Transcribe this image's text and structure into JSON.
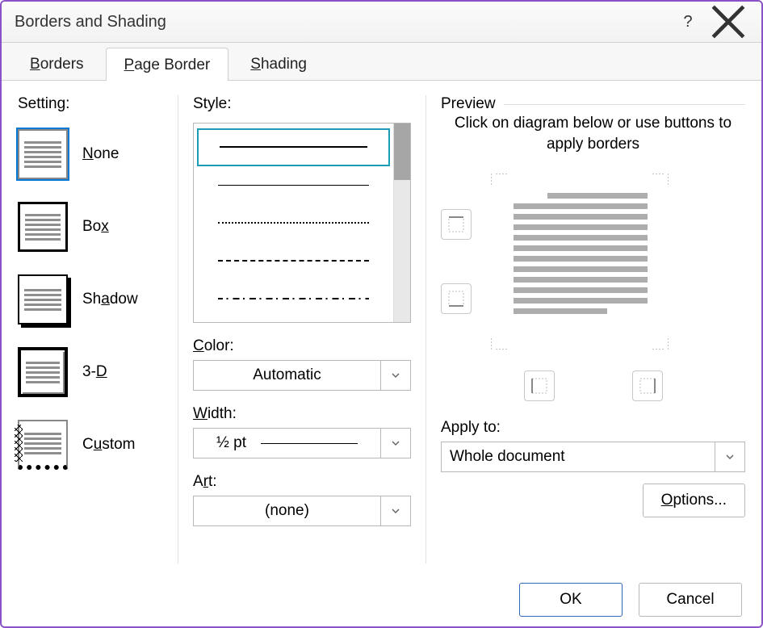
{
  "window": {
    "title": "Borders and Shading"
  },
  "tabs": {
    "borders": "Borders",
    "page_border": "Page Border",
    "shading": "Shading",
    "active": "page_border"
  },
  "setting": {
    "group_label": "Setting:",
    "items": {
      "none": "None",
      "box": "Box",
      "shadow": "Shadow",
      "threed": "3-D",
      "custom": "Custom"
    },
    "selected": "none"
  },
  "style": {
    "group_label": "Style:",
    "selected_index": 0,
    "options": [
      "solid",
      "hairline",
      "dotted",
      "dashed",
      "dash-dot"
    ]
  },
  "color": {
    "label": "Color:",
    "value": "Automatic"
  },
  "width": {
    "label": "Width:",
    "value": "½ pt"
  },
  "art": {
    "label": "Art:",
    "value": "(none)"
  },
  "preview": {
    "group_label": "Preview",
    "hint": "Click on diagram below or use buttons to apply borders"
  },
  "apply_to": {
    "label": "Apply to:",
    "value": "Whole document"
  },
  "buttons": {
    "options": "Options...",
    "ok": "OK",
    "cancel": "Cancel"
  }
}
